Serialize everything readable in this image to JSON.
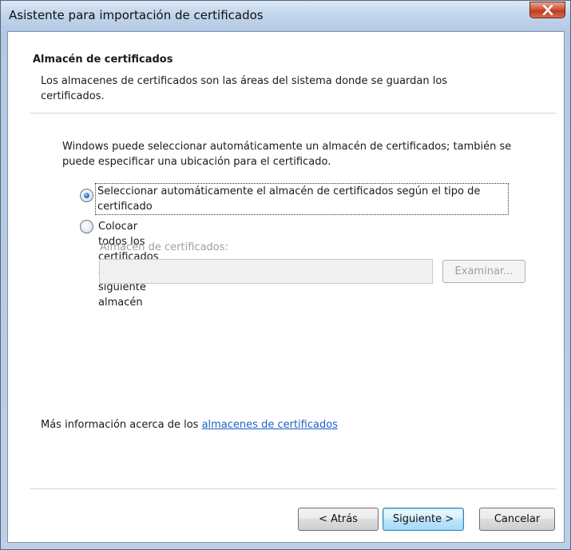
{
  "window": {
    "title": "Asistente para importación de certificados"
  },
  "header": {
    "title": "Almacén de certificados",
    "description": "Los almacenes de certificados son las áreas del sistema donde se guardan los certificados."
  },
  "body": {
    "intro": "Windows puede seleccionar automáticamente un almacén de certificados; también se puede especificar una ubicación para el certificado.",
    "options": [
      {
        "label": "Seleccionar automáticamente el almacén de certificados según el tipo de certificado",
        "checked": true
      },
      {
        "label": "Colocar todos los certificados en el siguiente almacén",
        "checked": false
      }
    ],
    "store_label": "Almacén de certificados:",
    "store_value": "",
    "examine_button": "Examinar..."
  },
  "footer": {
    "more_info_prefix": "Más información acerca de los ",
    "more_info_link": "almacenes de certificados",
    "back_button": "< Atrás",
    "next_button": "Siguiente >",
    "cancel_button": "Cancelar"
  }
}
